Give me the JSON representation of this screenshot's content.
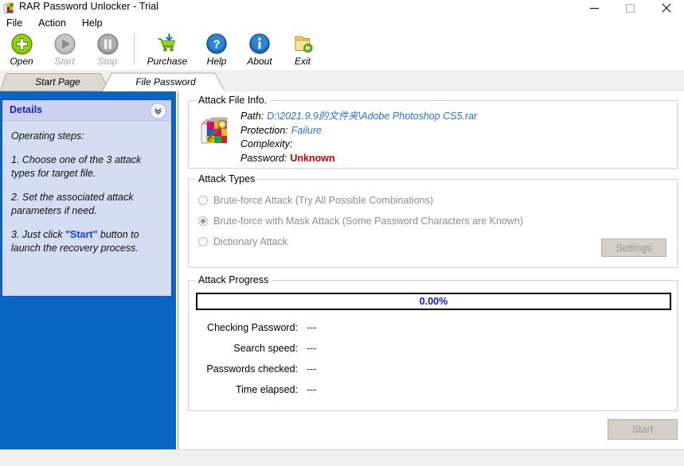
{
  "window": {
    "title": "RAR Password Unlocker - Trial",
    "app_icon": "rar-archive-icon",
    "controls": {
      "minimize": "minimize-icon",
      "maximize": "maximize-icon",
      "close": "close-icon"
    }
  },
  "menubar": {
    "items": [
      {
        "label": "File"
      },
      {
        "label": "Action"
      },
      {
        "label": "Help"
      }
    ]
  },
  "toolbar": {
    "buttons": [
      {
        "label": "Open",
        "icon": "green-plus-circle-icon",
        "enabled": true
      },
      {
        "label": "Start",
        "icon": "play-circle-icon",
        "enabled": false
      },
      {
        "label": "Stop",
        "icon": "pause-circle-icon",
        "enabled": false
      },
      {
        "label": "Purchase",
        "icon": "shopping-cart-icon",
        "enabled": true
      },
      {
        "label": "Help",
        "icon": "question-circle-icon",
        "enabled": true
      },
      {
        "label": "About",
        "icon": "info-circle-icon",
        "enabled": true
      },
      {
        "label": "Exit",
        "icon": "folder-exit-icon",
        "enabled": true
      }
    ]
  },
  "tabs": [
    {
      "label": "Start Page",
      "active": false
    },
    {
      "label": "File Password",
      "active": true
    }
  ],
  "details_panel": {
    "title": "Details",
    "collapse_icon": "double-chevron-down-icon",
    "intro": "Operating steps:",
    "steps": [
      {
        "text_before": "1. Choose one of the 3 attack types for target file.",
        "highlight": "",
        "text_after": ""
      },
      {
        "text_before": "2. Set the associated attack parameters if need.",
        "highlight": "",
        "text_after": ""
      },
      {
        "text_before": "3. Just click  ",
        "highlight": "\"Start\"",
        "text_after": " button to launch the recovery process."
      }
    ]
  },
  "file_info": {
    "group_title": "Attack File Info.",
    "icon": "rar-with-key-icon",
    "rows": [
      {
        "key": "Path:",
        "value": "D:\\2021.9.9的文件夹\\Adobe Photoshop CS5.rar",
        "style": "link"
      },
      {
        "key": "Protection:",
        "value": "Failure",
        "style": "link"
      },
      {
        "key": "Complexity:",
        "value": "",
        "style": "link"
      },
      {
        "key": "Password:",
        "value": "Unknown",
        "style": "danger"
      }
    ]
  },
  "attack_types": {
    "group_title": "Attack Types",
    "enabled": false,
    "options": [
      {
        "label": "Brute-force Attack (Try All Possible Combinations)",
        "selected": false
      },
      {
        "label": "Brute-force with Mask Attack (Some Password Characters are Known)",
        "selected": true
      },
      {
        "label": "Dictionary Attack",
        "selected": false
      }
    ],
    "settings_button": {
      "label": "Settings",
      "enabled": false
    }
  },
  "attack_progress": {
    "group_title": "Attack Progress",
    "progress_percent": "0.00%",
    "progress_value": 0,
    "stats": [
      {
        "label": "Checking Password:",
        "value": "---"
      },
      {
        "label": "Search speed:",
        "value": "---"
      },
      {
        "label": "Passwords checked:",
        "value": "---"
      },
      {
        "label": "Time elapsed:",
        "value": "---"
      }
    ]
  },
  "start_button": {
    "label": "Start",
    "enabled": false
  },
  "colors": {
    "sidebar_blue": "#0a66c2",
    "details_bg": "#d5ddf2",
    "details_title": "#1a1ad6",
    "link_blue": "#2a6fd6",
    "danger_red": "#cc0000",
    "progress_text": "#1111cc"
  }
}
